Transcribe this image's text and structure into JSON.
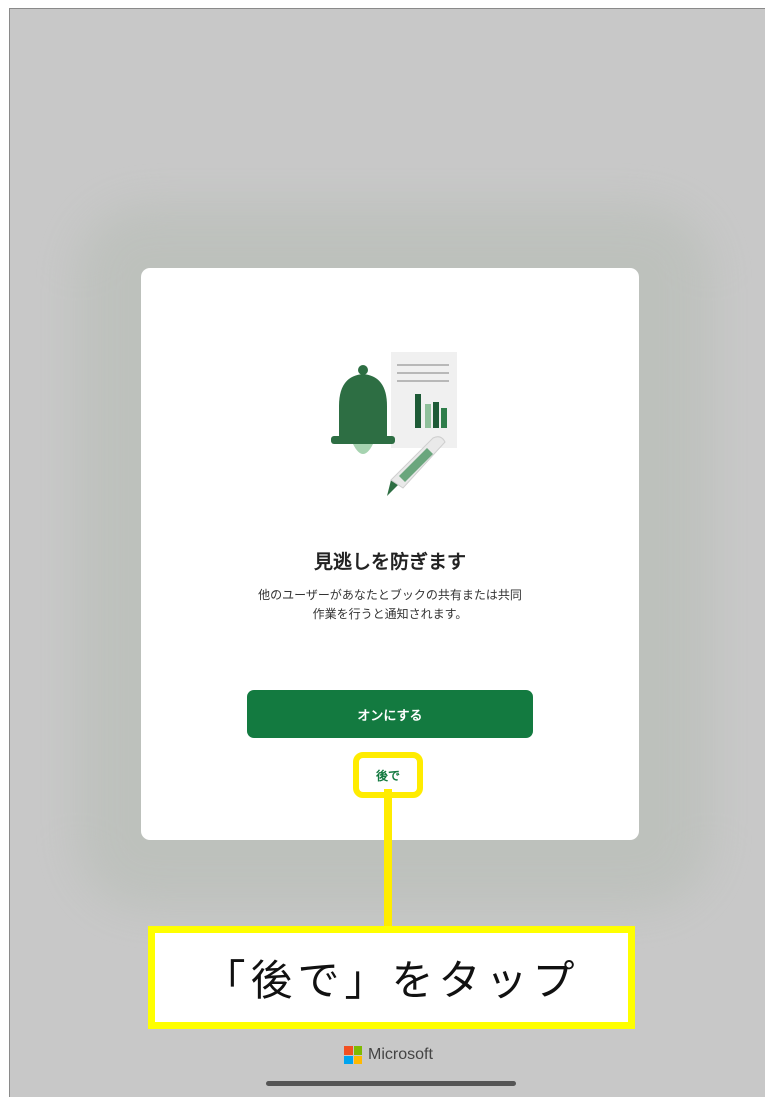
{
  "dialog": {
    "title": "見逃しを防ぎます",
    "description_line1": "他のユーザーがあなたとブックの共有または共同",
    "description_line2": "作業を行うと通知されます。",
    "primary_button": "オンにする",
    "later_button": "後で"
  },
  "annotation": {
    "instruction": "「後で」をタップ",
    "highlight_color": "#ffff00"
  },
  "footer": {
    "brand": "Microsoft"
  },
  "colors": {
    "accent_green": "#137a40",
    "backdrop": "#c8c8c8"
  },
  "icons": [
    "bell-icon",
    "document-chart-icon",
    "pen-icon",
    "microsoft-logo-icon"
  ]
}
